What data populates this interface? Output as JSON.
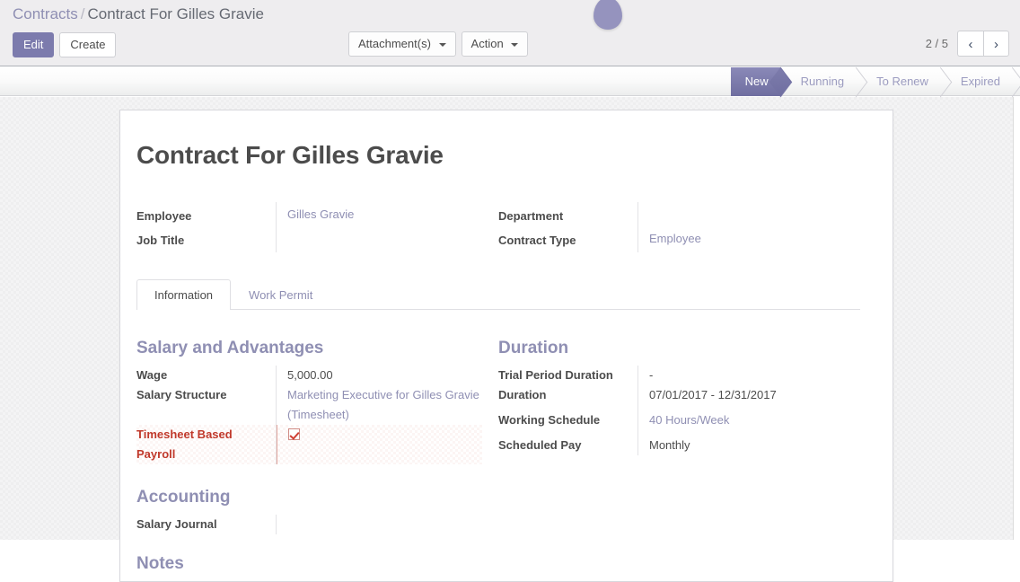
{
  "breadcrumb": {
    "root": "Contracts",
    "separator": "/",
    "current": "Contract For Gilles Gravie"
  },
  "toolbar": {
    "edit_label": "Edit",
    "create_label": "Create",
    "attachments_label": "Attachment(s)",
    "action_label": "Action"
  },
  "pager": {
    "count": "2 / 5",
    "prev_glyph": "‹",
    "next_glyph": "›"
  },
  "statusbar": {
    "stages": [
      {
        "label": "New",
        "active": true
      },
      {
        "label": "Running",
        "active": false
      },
      {
        "label": "To Renew",
        "active": false
      },
      {
        "label": "Expired",
        "active": false
      }
    ]
  },
  "form": {
    "title": "Contract For Gilles Gravie",
    "header_fields_left": [
      {
        "label": "Employee",
        "value": "Gilles Gravie",
        "is_link": true
      },
      {
        "label": "Job Title",
        "value": "",
        "is_link": false
      }
    ],
    "header_fields_right": [
      {
        "label": "Department",
        "value": "",
        "is_link": false
      },
      {
        "label": "Contract Type",
        "value": "Employee",
        "is_link": true
      }
    ],
    "tabs": [
      {
        "label": "Information",
        "active": true
      },
      {
        "label": "Work Permit",
        "active": false
      }
    ],
    "groups": {
      "salary": {
        "title": "Salary and Advantages",
        "rows": [
          {
            "label": "Wage",
            "value": "5,000.00",
            "is_link": false
          },
          {
            "label": "Salary Structure",
            "value": "Marketing Executive for Gilles Gravie (Timesheet)",
            "is_link": true
          },
          {
            "label": "Timesheet Based Payroll",
            "value": "",
            "is_link": false,
            "checkbox": true,
            "checked": true,
            "highlight": true
          }
        ]
      },
      "duration": {
        "title": "Duration",
        "rows": [
          {
            "label": "Trial Period Duration",
            "value": "-",
            "is_link": false
          },
          {
            "label": "Duration",
            "value": "07/01/2017 - 12/31/2017",
            "is_link": false
          },
          {
            "label": "Working Schedule",
            "value": "40 Hours/Week",
            "is_link": true
          },
          {
            "label": "Scheduled Pay",
            "value": "Monthly",
            "is_link": false
          }
        ]
      },
      "accounting": {
        "title": "Accounting",
        "rows": [
          {
            "label": "Salary Journal",
            "value": "",
            "is_link": false
          }
        ]
      },
      "notes": {
        "title": "Notes"
      }
    }
  },
  "colors": {
    "brand_purple": "#7c7bad",
    "link_purple": "#8f8fb3",
    "alert_red": "#c0392b",
    "page_bg": "#f4f4f5",
    "panel_bg": "#eeedef"
  }
}
